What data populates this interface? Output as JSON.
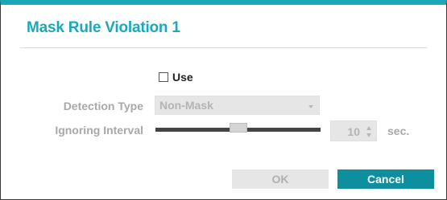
{
  "dialog": {
    "title": "Mask Rule Violation 1",
    "use": {
      "label": "Use",
      "checked": false
    },
    "detection_type": {
      "label": "Detection Type",
      "value": "Non-Mask"
    },
    "ignoring_interval": {
      "label": "Ignoring Interval",
      "value": "10",
      "unit": "sec.",
      "slider_fraction": 0.5
    },
    "buttons": {
      "ok": "OK",
      "cancel": "Cancel"
    }
  },
  "colors": {
    "accent": "#1aa7b8",
    "cancel_button": "#0e8fa0",
    "disabled_text": "#a8a8a8"
  }
}
